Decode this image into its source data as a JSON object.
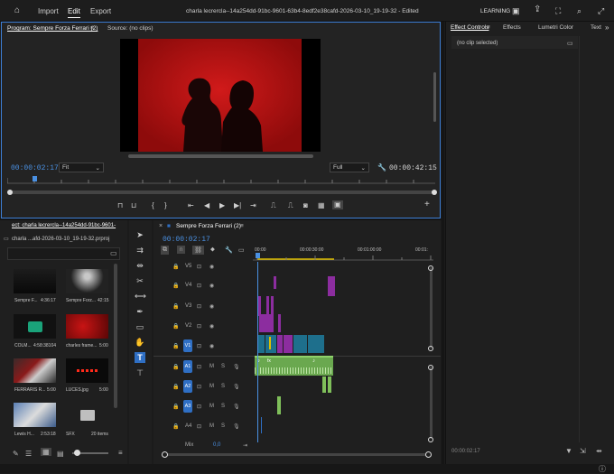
{
  "topbar": {
    "menu": [
      "Import",
      "Edit",
      "Export"
    ],
    "title": "charla lecrercla--14a254dd-91bc-9601-63b4-8edf2e38cafd-2026-03-10_19-19-32 - Edited",
    "workspace": "LEARNING"
  },
  "program": {
    "tab_program": "Program: Sempre Forza Ferrari (2)",
    "tab_source": "Source: (no clips)",
    "timecode_current": "00:00:02:17",
    "zoom": "Fit",
    "quality": "Full",
    "timecode_duration": "00:00:42:15"
  },
  "effects": {
    "tabs": [
      "Effect Controls",
      "Effects",
      "Lumetri Color",
      "Text"
    ],
    "no_clip": "(no clip selected)",
    "footer_timecode": "00:00:02:17"
  },
  "project": {
    "tab": "ect: charla lecrercla--14a254dd-91bc-9601-",
    "file": "charla ...afd-2026-03-10_19-19-32.prproj",
    "items": [
      {
        "label": "Sempre F...",
        "duration": "4:36:17"
      },
      {
        "label": "Sempre Forz...",
        "duration": "42:15"
      },
      {
        "label": "COLM...",
        "duration": "4:58:38104"
      },
      {
        "label": "charles frame...",
        "duration": "5:00"
      },
      {
        "label": "FERRARIS R...",
        "duration": "5:00"
      },
      {
        "label": "LUCES.jpg",
        "duration": "5:00"
      },
      {
        "label": "Lewis H...",
        "duration": "2:53:18"
      },
      {
        "label": "SFX",
        "duration": "20 items"
      }
    ]
  },
  "timeline": {
    "sequence": "Sempre Forza Ferrari (2)",
    "timecode": "00:00:02:17",
    "ruler": [
      "00:00",
      "00:00:30:00",
      "00:01:00:00",
      "00:01:"
    ],
    "video_tracks": [
      "V5",
      "V4",
      "V3",
      "V2",
      "V1"
    ],
    "audio_tracks": [
      "A1",
      "A2",
      "A3",
      "A4"
    ],
    "mix_label": "Mix",
    "mix_value": "0,0",
    "mute": "M",
    "solo": "S",
    "active_video": "V1",
    "fx_label": "fx"
  },
  "colors": {
    "accent": "#4a90e2",
    "video_clip": "#8c2d9f",
    "video_clip_teal": "#1e6f8c",
    "audio_clip": "#7fbf5a"
  }
}
